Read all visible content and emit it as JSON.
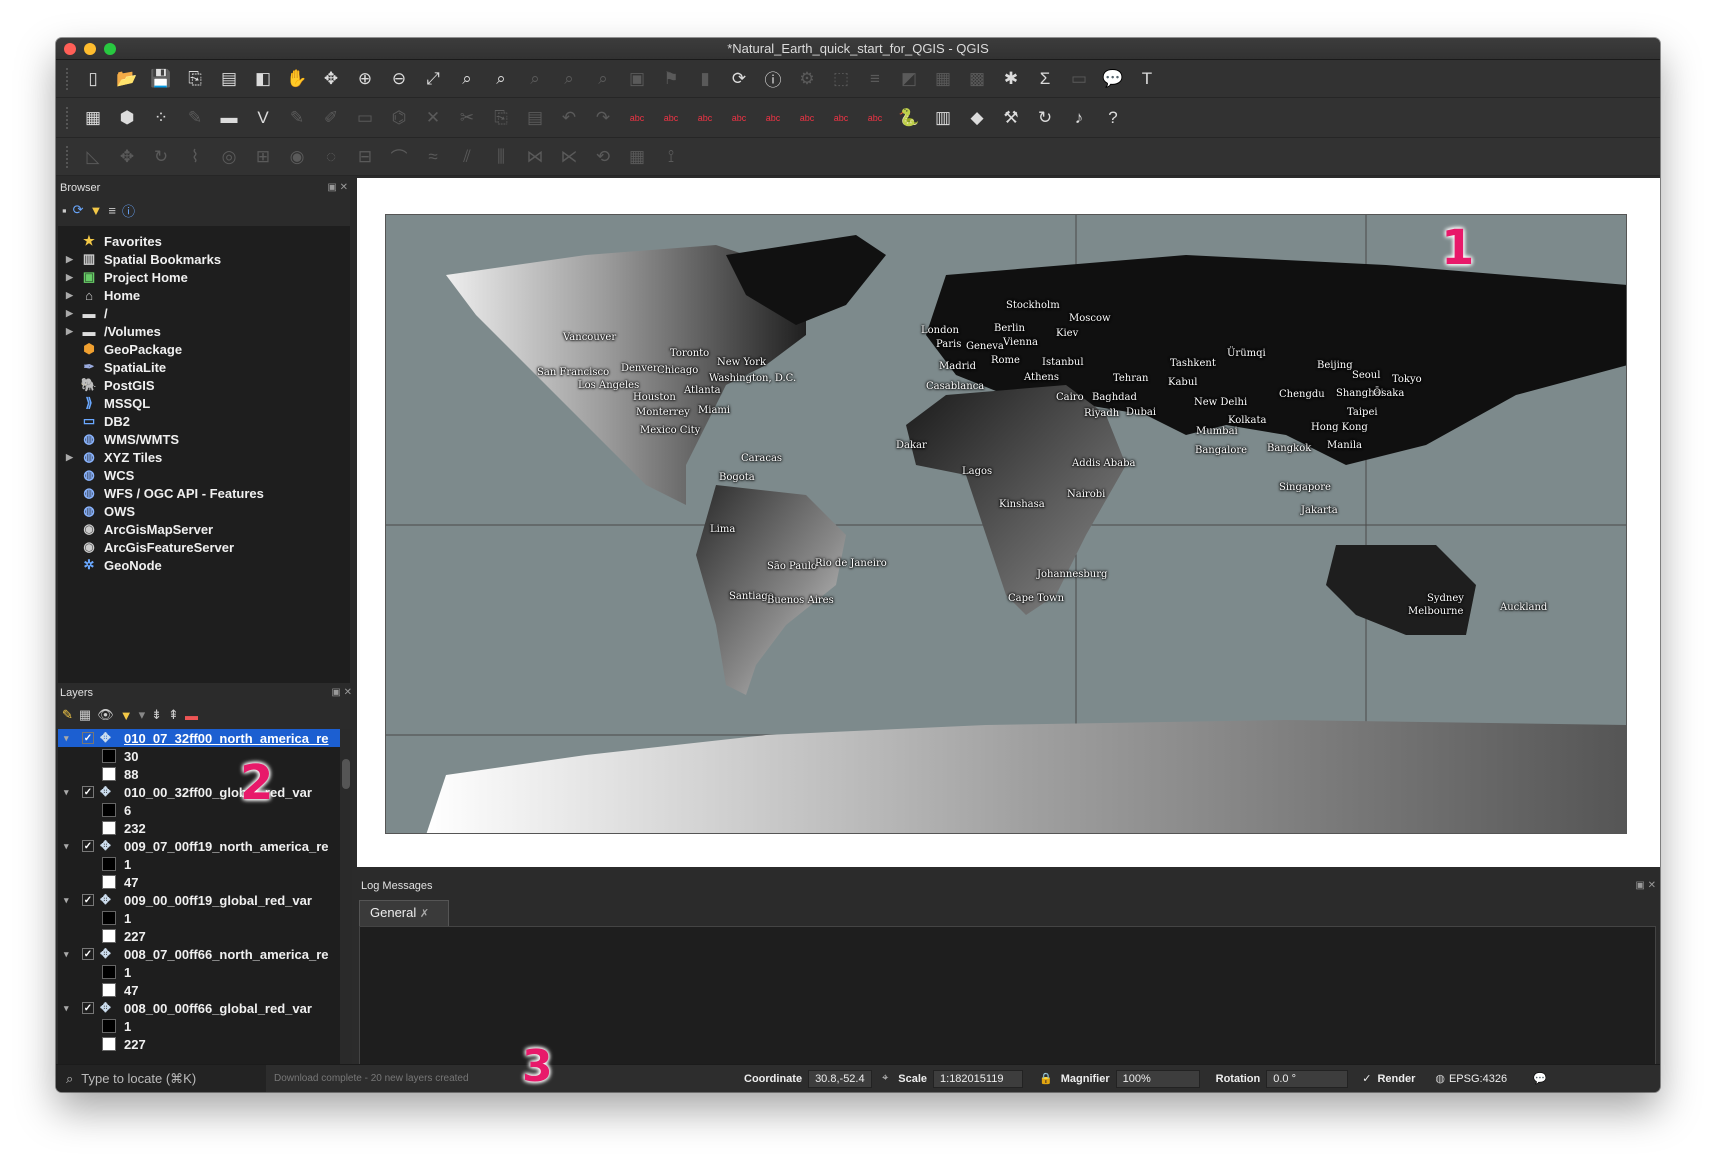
{
  "window": {
    "title": "*Natural_Earth_quick_start_for_QGIS - QGIS"
  },
  "colors": {
    "accent": "#1c5fd1",
    "annotation": "#e8196a",
    "map_bg": "#7d8a8c",
    "panel": "#2b2b2b"
  },
  "toolbar1": [
    "new-project-icon",
    "open-project-icon",
    "save-project-icon",
    "save-as-icon",
    "print-layout-icon",
    "style-manager-icon",
    "pan-hand-icon",
    "pan-to-selection-icon",
    "zoom-in-icon",
    "zoom-out-icon",
    "zoom-full-icon",
    "zoom-to-selection-icon",
    "zoom-to-layer-icon",
    "zoom-native-icon",
    "zoom-last-icon",
    "zoom-next-icon",
    "new-map-view-icon",
    "new-bookmark-icon",
    "show-bookmarks-icon",
    "refresh-icon",
    "identify-icon",
    "actions-icon",
    "select-features-icon",
    "select-by-value-icon",
    "deselect-icon",
    "attribute-table-icon",
    "field-calculator-icon",
    "toolbox-icon",
    "statistics-icon",
    "measure-icon",
    "map-tips-icon",
    "text-annotation-icon"
  ],
  "toolbar2": [
    "data-source-manager-icon",
    "new-geopackage-layer-icon",
    "new-temp-layer-icon",
    "digitize-icon",
    "save-edits-icon",
    "layer-diagram-icon",
    "toggle-editing-icon",
    "current-edits-icon",
    "add-feature-icon",
    "vertex-tool-icon",
    "delete-selected-icon",
    "cut-features-icon",
    "copy-features-icon",
    "paste-features-icon",
    "undo-icon",
    "redo-icon",
    "label-tool-icon",
    "pin-labels-icon",
    "label-highlight-icon",
    "show-labels-icon",
    "move-label-icon",
    "rotate-label-icon",
    "change-label-icon",
    "label-toolbar-icon",
    "python-console-icon",
    "plugin-icon",
    "plugin-green-icon",
    "plugin-wand-icon",
    "plugin-arrow-icon",
    "plugin-music-icon",
    "help-icon"
  ],
  "toolbar3": [
    "advanced-digitize-icon",
    "move-feature-icon",
    "rotate-feature-icon",
    "simplify-icon",
    "add-ring-icon",
    "add-part-icon",
    "fill-ring-icon",
    "delete-ring-icon",
    "delete-part-icon",
    "reshape-icon",
    "offset-curve-icon",
    "split-features-icon",
    "split-parts-icon",
    "merge-features-icon",
    "merge-attributes-icon",
    "rotate-point-icon",
    "tracing-icon",
    "snapping-icon"
  ],
  "browser": {
    "title": "Browser",
    "items": [
      {
        "label": "Favorites",
        "icon": "star-icon",
        "expandable": false
      },
      {
        "label": "Spatial Bookmarks",
        "icon": "bookmark-icon",
        "expandable": true
      },
      {
        "label": "Project Home",
        "icon": "project-home-icon",
        "expandable": true
      },
      {
        "label": "Home",
        "icon": "home-folder-icon",
        "expandable": true
      },
      {
        "label": "/",
        "icon": "folder-icon",
        "expandable": true
      },
      {
        "label": "/Volumes",
        "icon": "folder-icon",
        "expandable": true
      },
      {
        "label": "GeoPackage",
        "icon": "geopackage-icon",
        "expandable": false
      },
      {
        "label": "SpatiaLite",
        "icon": "spatialite-icon",
        "expandable": false
      },
      {
        "label": "PostGIS",
        "icon": "postgis-icon",
        "expandable": false
      },
      {
        "label": "MSSQL",
        "icon": "mssql-icon",
        "expandable": false
      },
      {
        "label": "DB2",
        "icon": "db2-icon",
        "expandable": false
      },
      {
        "label": "WMS/WMTS",
        "icon": "globe-icon",
        "expandable": false
      },
      {
        "label": "XYZ Tiles",
        "icon": "globe-icon",
        "expandable": true
      },
      {
        "label": "WCS",
        "icon": "globe-icon",
        "expandable": false
      },
      {
        "label": "WFS / OGC API - Features",
        "icon": "globe-icon",
        "expandable": false
      },
      {
        "label": "OWS",
        "icon": "globe-icon",
        "expandable": false
      },
      {
        "label": "ArcGisMapServer",
        "icon": "arcgis-icon",
        "expandable": false
      },
      {
        "label": "ArcGisFeatureServer",
        "icon": "arcgis-icon",
        "expandable": false
      },
      {
        "label": "GeoNode",
        "icon": "geonode-icon",
        "expandable": false
      }
    ]
  },
  "layers": {
    "title": "Layers",
    "items": [
      {
        "name": "010_07_32ff00_north_america_re",
        "selected": true,
        "classes": [
          {
            "label": "30",
            "color": "#000000"
          },
          {
            "label": "88",
            "color": "#ffffff"
          }
        ]
      },
      {
        "name": "010_00_32ff00_global_red_var",
        "selected": false,
        "classes": [
          {
            "label": "6",
            "color": "#000000"
          },
          {
            "label": "232",
            "color": "#ffffff"
          }
        ]
      },
      {
        "name": "009_07_00ff19_north_america_re",
        "selected": false,
        "classes": [
          {
            "label": "1",
            "color": "#000000"
          },
          {
            "label": "47",
            "color": "#ffffff"
          }
        ]
      },
      {
        "name": "009_00_00ff19_global_red_var",
        "selected": false,
        "classes": [
          {
            "label": "1",
            "color": "#000000"
          },
          {
            "label": "227",
            "color": "#ffffff"
          }
        ]
      },
      {
        "name": "008_07_00ff66_north_america_re",
        "selected": false,
        "classes": [
          {
            "label": "1",
            "color": "#000000"
          },
          {
            "label": "47",
            "color": "#ffffff"
          }
        ]
      },
      {
        "name": "008_00_00ff66_global_red_var",
        "selected": false,
        "classes": [
          {
            "label": "1",
            "color": "#000000"
          },
          {
            "label": "227",
            "color": "#ffffff"
          }
        ]
      }
    ]
  },
  "map": {
    "cities": [
      "Stockholm",
      "Moscow",
      "Berlin",
      "London",
      "Kiev",
      "Paris",
      "Geneva",
      "Vienna",
      "Ürümqi",
      "Tashkent",
      "Beijing",
      "Seoul",
      "Tokyo",
      "Vancouver",
      "Toronto",
      "New York",
      "Denver",
      "Chicago",
      "Washington, D.C.",
      "San Francisco",
      "Los Angeles",
      "Atlanta",
      "Madrid",
      "Rome",
      "Istanbul",
      "Athens",
      "Tehran",
      "Kabul",
      "Casablanca",
      "Cairo",
      "Baghdad",
      "New Delhi",
      "Chengdu",
      "Shanghai",
      "Ōsaka",
      "Houston",
      "Monterrey",
      "Miami",
      "Riyadh",
      "Dubai",
      "Taipei",
      "Kolkata",
      "Mexico City",
      "Mumbai",
      "Hong Kong",
      "Dakar",
      "Bangkok",
      "Manila",
      "Bangalore",
      "Caracas",
      "Addis Ababa",
      "Lagos",
      "Bogota",
      "Singapore",
      "Nairobi",
      "Kinshasa",
      "Jakarta",
      "Lima",
      "São Paulo",
      "Rio de Janeiro",
      "Johannesburg",
      "Santiago",
      "Buenos Aires",
      "Cape Town",
      "Sydney",
      "Melbourne",
      "Auckland"
    ]
  },
  "annotations": {
    "one": "1",
    "two": "2",
    "three": "3"
  },
  "log": {
    "title": "Log Messages",
    "tab": "General"
  },
  "status": {
    "locate_placeholder": "Type to locate (⌘K)",
    "message": "Download complete - 20 new layers created",
    "coordinate_label": "Coordinate",
    "coordinate": "30.8,-52.4",
    "scale_label": "Scale",
    "scale": "1:182015119",
    "magnifier_label": "Magnifier",
    "magnifier": "100%",
    "rotation_label": "Rotation",
    "rotation": "0.0 °",
    "render_label": "Render",
    "crs": "EPSG:4326"
  }
}
